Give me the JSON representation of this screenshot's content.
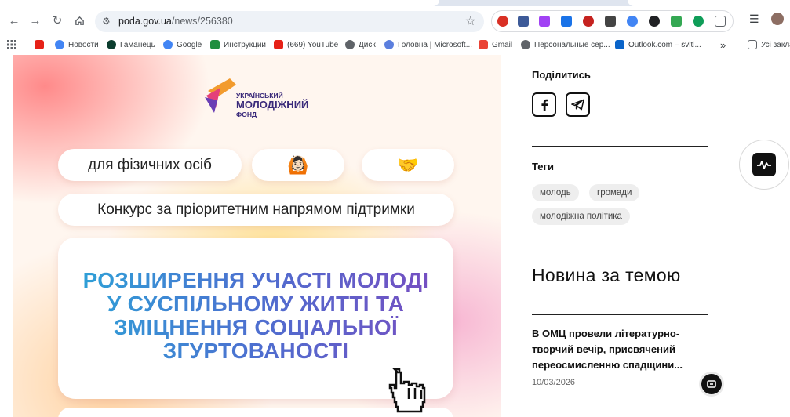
{
  "browser": {
    "url_host": "poda.gov.ua",
    "url_path": "/news/256380",
    "bookmarks": [
      {
        "label": ""
      },
      {
        "label": "Новости"
      },
      {
        "label": "Гаманець"
      },
      {
        "label": "Google"
      },
      {
        "label": "Инструкции"
      },
      {
        "label": "(669) YouTube"
      },
      {
        "label": "Диск"
      },
      {
        "label": "Головна | Microsoft..."
      },
      {
        "label": "Gmail"
      },
      {
        "label": "Персональные сер..."
      },
      {
        "label": "Outlook.com – sviti..."
      },
      {
        "label": "Усі закла"
      }
    ],
    "more_bookmarks": "»"
  },
  "poster": {
    "logo_line1": "УКРАЇНСЬКИЙ",
    "logo_line2": "МОЛОДІЖНИЙ",
    "logo_line3": "ФОНД",
    "pill_1": "для фізичних осіб",
    "pill_2_emoji": "🙆🏻",
    "pill_3_emoji": "🤝",
    "pill_4": "Конкурс за пріоритетним напрямом підтримки",
    "headline_1": "РОЗШИРЕННЯ УЧАСТІ МОЛОДІ",
    "headline_2": "У СУСПІЛЬНОМУ ЖИТТІ ТА",
    "headline_3": "ЗМІЦНЕННЯ СОЦІАЛЬНОЇ",
    "headline_4": "ЗГУРТОВАНОСТІ"
  },
  "sidebar": {
    "share_title": "Поділитись",
    "tags_title": "Теги",
    "tags": [
      "молодь",
      "громади",
      "молодіжна політика"
    ],
    "related_title": "Новина за темою",
    "related_news": {
      "title": "В ОМЦ провели літературно-творчий вечір, присвячений переосмисленню спадщини...",
      "date": "10/03/2026"
    }
  }
}
